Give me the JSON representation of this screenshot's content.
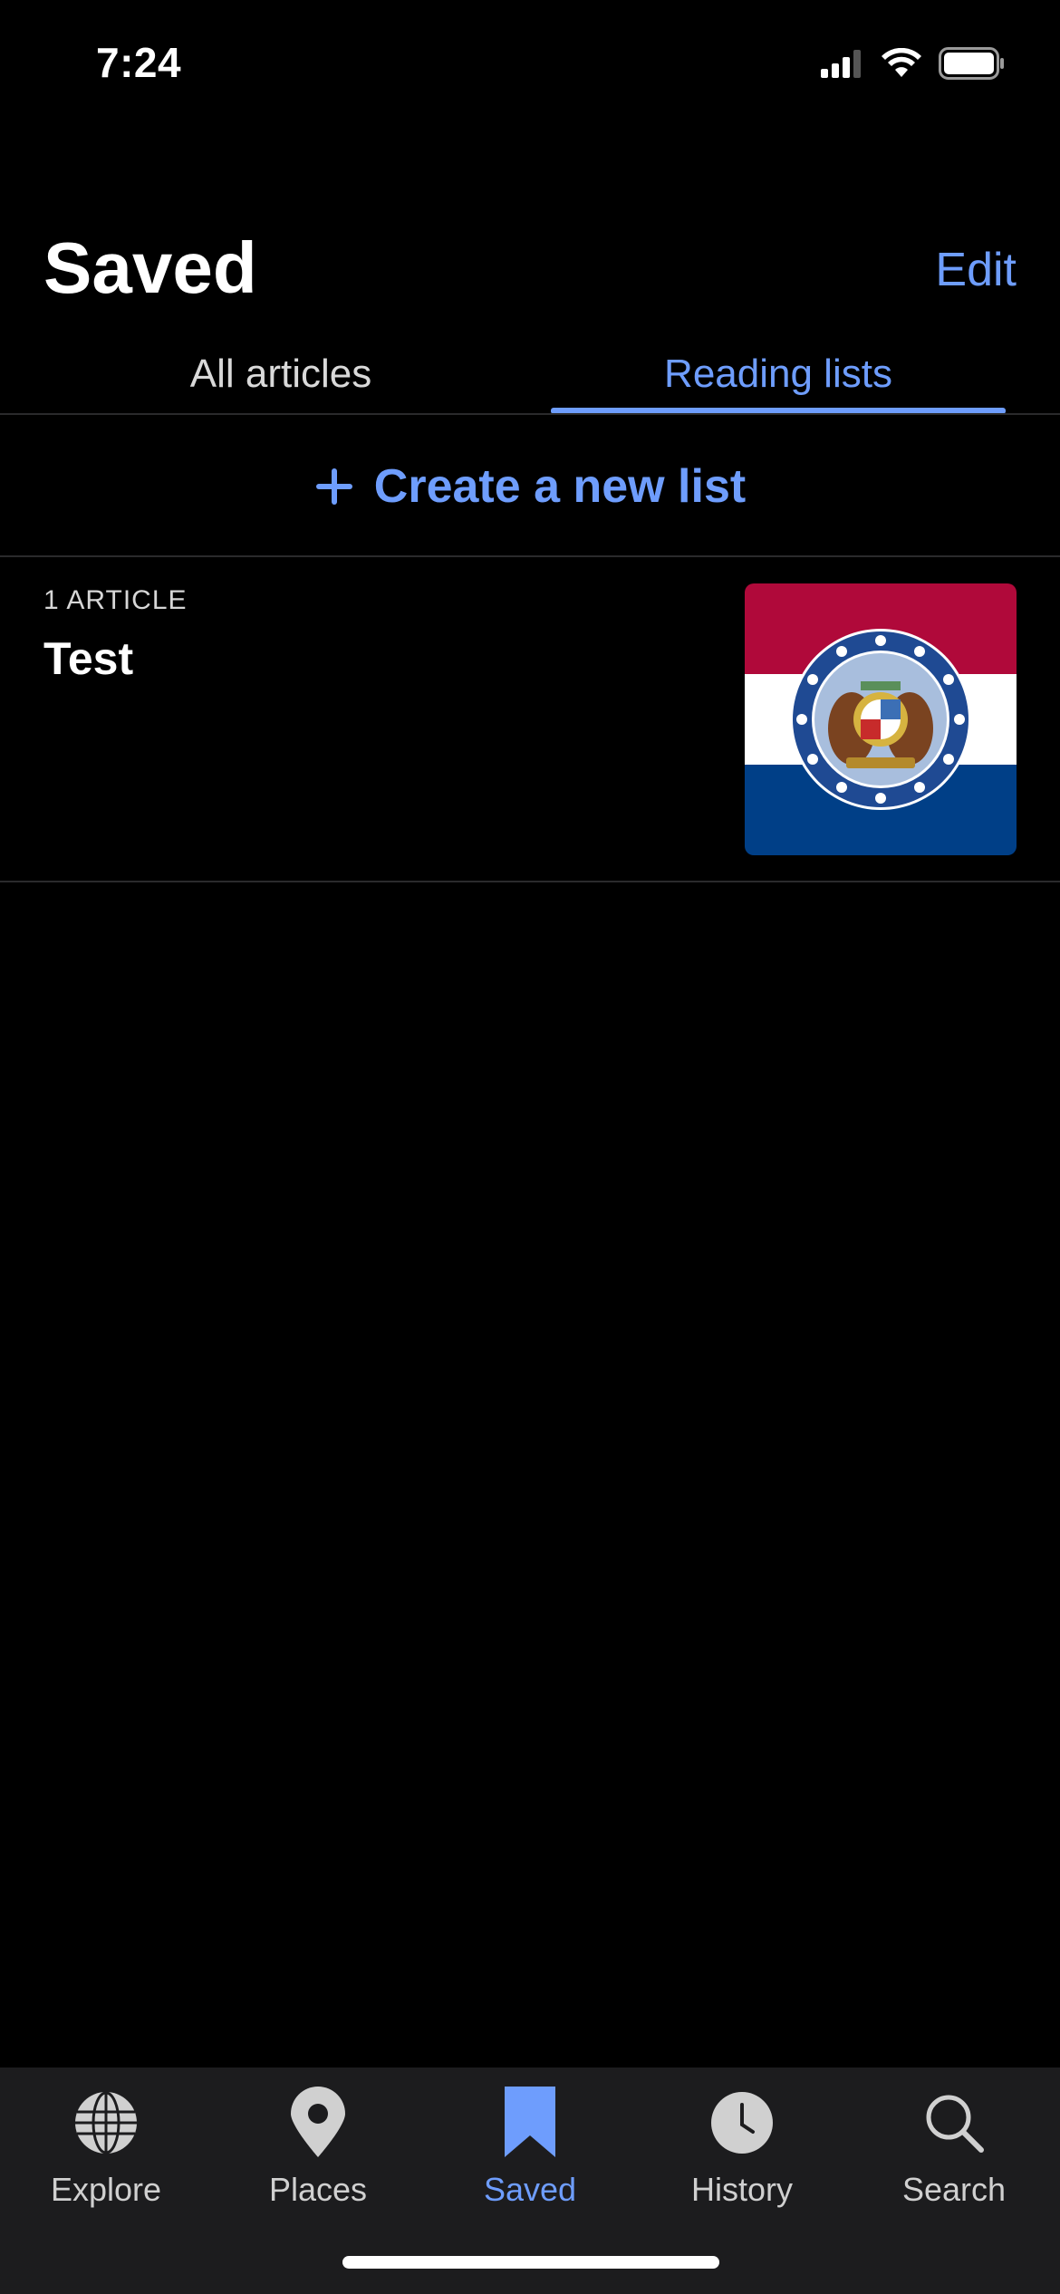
{
  "status_bar": {
    "time": "7:24"
  },
  "header": {
    "title": "Saved",
    "edit_label": "Edit"
  },
  "tabs": {
    "all_articles": "All articles",
    "reading_lists": "Reading lists",
    "active": "reading_lists"
  },
  "create_list": {
    "label": "Create a new list"
  },
  "reading_lists": [
    {
      "count_label": "1 ARTICLE",
      "title": "Test",
      "thumbnail": "flag-of-missouri"
    }
  ],
  "tab_bar": {
    "items": [
      {
        "label": "Explore",
        "icon": "globe-icon"
      },
      {
        "label": "Places",
        "icon": "map-pin-icon"
      },
      {
        "label": "Saved",
        "icon": "bookmark-icon",
        "active": true
      },
      {
        "label": "History",
        "icon": "clock-icon"
      },
      {
        "label": "Search",
        "icon": "search-icon"
      }
    ]
  },
  "colors": {
    "accent": "#6e9dfd",
    "background": "#000000",
    "tabbar": "#1c1c1e"
  }
}
